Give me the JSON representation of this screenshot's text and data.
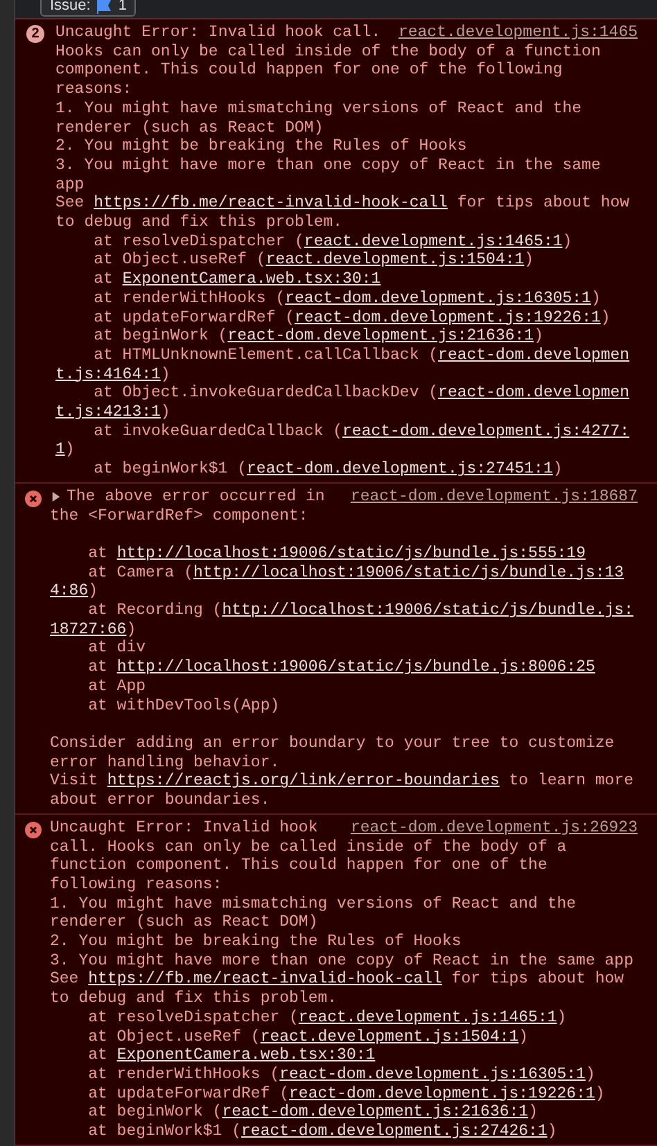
{
  "issues_button": {
    "label": "Issue:",
    "count": "1"
  },
  "messages": [
    {
      "count": "2",
      "expandable": false,
      "source": "react.development.js:1465",
      "blocks": [
        {
          "kind": "line",
          "before": "Uncaught Error: Invalid hook call. Hooks can only be called inside of the body of a function component. This could happen for one of the following reasons:"
        },
        {
          "kind": "line",
          "before": "1. You might have mismatching versions of React and the renderer (such as React DOM)"
        },
        {
          "kind": "line",
          "before": "2. You might be breaking the Rules of Hooks"
        },
        {
          "kind": "line",
          "before": "3. You might have more than one copy of React in the same app"
        },
        {
          "kind": "line",
          "before": "See ",
          "link": [
            "https://fb.me/react-invalid-hook-call"
          ],
          "after": " for tips about how to debug and fix this problem."
        },
        {
          "kind": "frame",
          "before": "at resolveDispatcher (",
          "link": [
            "react.development.js:1465:1"
          ],
          "after": ")"
        },
        {
          "kind": "frame",
          "before": "at Object.useRef (",
          "link": [
            "react.development.js:1504:1"
          ],
          "after": ")"
        },
        {
          "kind": "frame",
          "before": "at ",
          "link": [
            "ExponentCamera.web.tsx:30:1"
          ]
        },
        {
          "kind": "frame",
          "before": "at renderWithHooks (",
          "link": [
            "react-dom.development.js:16305:1"
          ],
          "after": ")"
        },
        {
          "kind": "frame",
          "before": "at updateForwardRef (",
          "link": [
            "react-dom.development.js:19226:1"
          ],
          "after": ")"
        },
        {
          "kind": "frame",
          "before": "at beginWork (",
          "link": [
            "react-dom.development.js:21636:1"
          ],
          "after": ")"
        },
        {
          "kind": "frame",
          "before": "at HTMLUnknownElement.callCallback (",
          "link": [
            "react-dom.developmen",
            "t.js:4164:1"
          ],
          "after": ")"
        },
        {
          "kind": "frame",
          "before": "at Object.invokeGuardedCallbackDev (",
          "link": [
            "react-dom.developmen",
            "t.js:4213:1"
          ],
          "after": ")"
        },
        {
          "kind": "frame",
          "before": "at invokeGuardedCallback (",
          "link": [
            "react-dom.development.js:4277:",
            "1"
          ],
          "after": ")"
        },
        {
          "kind": "frame",
          "before": "at beginWork$1 (",
          "link": [
            "react-dom.development.js:27451:1"
          ],
          "after": ")"
        }
      ]
    },
    {
      "expandable": true,
      "expanded": false,
      "source": "react-dom.development.js:18687",
      "blocks": [
        {
          "kind": "line",
          "before": "The above error occurred in the <ForwardRef> component:"
        },
        {
          "kind": "gap"
        },
        {
          "kind": "frame",
          "before": "at ",
          "link": [
            "http://localhost:19006/static/js/bundle.js:555:19"
          ]
        },
        {
          "kind": "frame",
          "before": "at Camera (",
          "link": [
            "http://localhost:19006/static/js/bundle.js:13",
            "4:86"
          ],
          "after": ")"
        },
        {
          "kind": "frame",
          "before": "at Recording (",
          "link": [
            "http://localhost:19006/static/js/bundle.js:",
            "18727:66"
          ],
          "after": ")"
        },
        {
          "kind": "frame",
          "before": "at div"
        },
        {
          "kind": "frame",
          "before": "at ",
          "link": [
            "http://localhost:19006/static/js/bundle.js:8006:25"
          ]
        },
        {
          "kind": "frame",
          "before": "at App"
        },
        {
          "kind": "frame",
          "before": "at withDevTools(App)"
        },
        {
          "kind": "gap"
        },
        {
          "kind": "line",
          "before": "Consider adding an error boundary to your tree to customize error handling behavior."
        },
        {
          "kind": "line",
          "before": "Visit ",
          "link": [
            "https://reactjs.org/link/error-boundaries"
          ],
          "after": " to learn more about error boundaries."
        }
      ]
    },
    {
      "expandable": false,
      "source": "react-dom.development.js:26923",
      "blocks": [
        {
          "kind": "line",
          "before": "Uncaught Error: Invalid hook call. Hooks can only be called inside of the body of a function component. This could happen for one of the following reasons:"
        },
        {
          "kind": "line",
          "before": "1. You might have mismatching versions of React and the renderer (such as React DOM)"
        },
        {
          "kind": "line",
          "before": "2. You might be breaking the Rules of Hooks"
        },
        {
          "kind": "line",
          "before": "3. You might have more than one copy of React in the same app"
        },
        {
          "kind": "line",
          "before": "See ",
          "link": [
            "https://fb.me/react-invalid-hook-call"
          ],
          "after": " for tips about how to debug and fix this problem."
        },
        {
          "kind": "frame",
          "before": "at resolveDispatcher (",
          "link": [
            "react.development.js:1465:1"
          ],
          "after": ")"
        },
        {
          "kind": "frame",
          "before": "at Object.useRef (",
          "link": [
            "react.development.js:1504:1"
          ],
          "after": ")"
        },
        {
          "kind": "frame",
          "before": "at ",
          "link": [
            "ExponentCamera.web.tsx:30:1"
          ]
        },
        {
          "kind": "frame",
          "before": "at renderWithHooks (",
          "link": [
            "react-dom.development.js:16305:1"
          ],
          "after": ")"
        },
        {
          "kind": "frame",
          "before": "at updateForwardRef (",
          "link": [
            "react-dom.development.js:19226:1"
          ],
          "after": ")"
        },
        {
          "kind": "frame",
          "before": "at beginWork (",
          "link": [
            "react-dom.development.js:21636:1"
          ],
          "after": ")"
        },
        {
          "kind": "frame",
          "before": "at beginWork$1 (",
          "link": [
            "react-dom.development.js:27426:1"
          ],
          "after": ")"
        }
      ]
    }
  ]
}
